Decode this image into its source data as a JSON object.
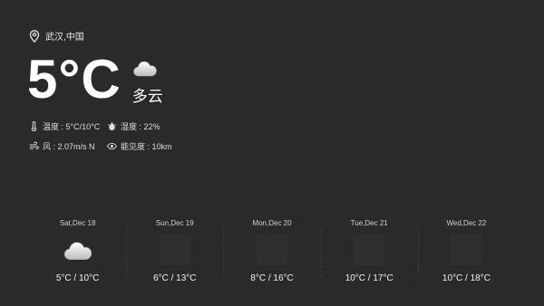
{
  "location": {
    "icon": "map-pin-icon",
    "text": "武汉,中国"
  },
  "current": {
    "temperature": "5°C",
    "condition": "多云",
    "condition_icon": "cloud-icon"
  },
  "details": [
    {
      "icon": "thermometer-icon",
      "text": "温度 : 5°C/10°C"
    },
    {
      "icon": "humidity-drop-icon",
      "text": "湿度 : 22%"
    },
    {
      "icon": "wind-icon",
      "text": "风 : 2.07m/s N"
    },
    {
      "icon": "eye-icon",
      "text": "能见度 : 10km"
    }
  ],
  "forecast": [
    {
      "date": "Sat,Dec 18",
      "range": "5°C / 10°C",
      "icon": "cloud-icon"
    },
    {
      "date": "Sun,Dec 19",
      "range": "6°C / 13°C",
      "icon": ""
    },
    {
      "date": "Mon,Dec 20",
      "range": "8°C / 16°C",
      "icon": ""
    },
    {
      "date": "Tue,Dec 21",
      "range": "10°C / 17°C",
      "icon": ""
    },
    {
      "date": "Wed,Dec 22",
      "range": "10°C / 18°C",
      "icon": ""
    }
  ],
  "colors": {
    "background": "#2a2a2b",
    "text": "#f2f2f2"
  }
}
